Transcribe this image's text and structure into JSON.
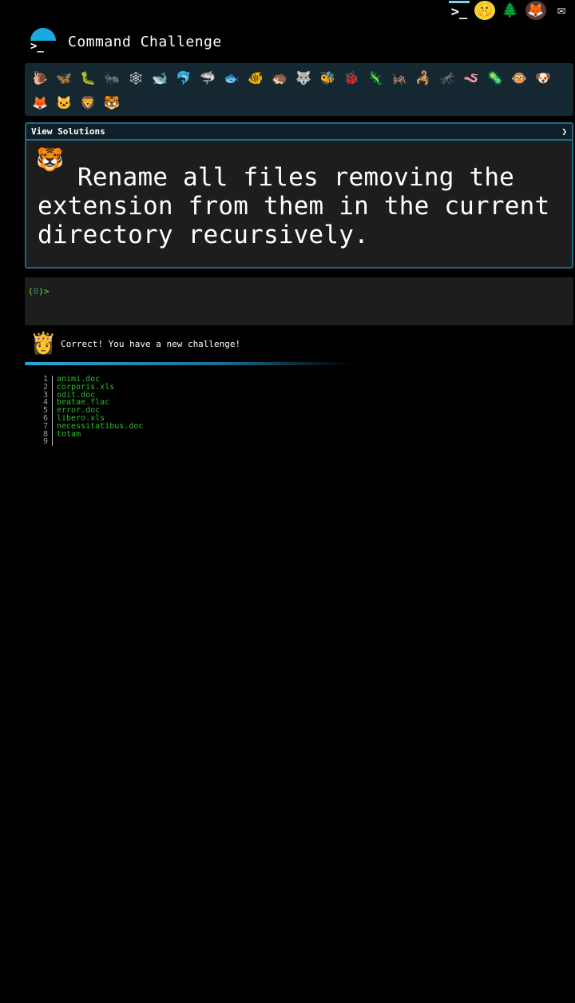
{
  "topbar": {
    "icons": [
      {
        "name": "terminal-icon",
        "glyph": ">_"
      },
      {
        "name": "quiet-face-icon",
        "glyph": "🤫"
      },
      {
        "name": "tree-icon",
        "glyph": "🌲"
      },
      {
        "name": "gitlab-icon",
        "glyph": "🦊"
      },
      {
        "name": "mail-icon",
        "glyph": "✉"
      }
    ]
  },
  "header": {
    "logo_prompt": ">_",
    "title": "Command Challenge"
  },
  "animals": [
    {
      "glyph": "🐌"
    },
    {
      "glyph": "🦋"
    },
    {
      "glyph": "🐛"
    },
    {
      "glyph": "🐜"
    },
    {
      "glyph": "🕸"
    },
    {
      "glyph": "🐋"
    },
    {
      "glyph": "🐬"
    },
    {
      "glyph": "🦈"
    },
    {
      "glyph": "🐟"
    },
    {
      "glyph": "🐠"
    },
    {
      "glyph": "🦔"
    },
    {
      "glyph": "🐺"
    },
    {
      "glyph": "🐝"
    },
    {
      "glyph": "🐞"
    },
    {
      "glyph": "🦎"
    },
    {
      "glyph": "🦗"
    },
    {
      "glyph": "🦂"
    },
    {
      "glyph": "🦟"
    },
    {
      "glyph": "🪱"
    },
    {
      "glyph": "🦠"
    },
    {
      "glyph": "🐵"
    },
    {
      "glyph": "🐶"
    },
    {
      "glyph": "🦊"
    },
    {
      "glyph": "🐱"
    },
    {
      "glyph": "🦁"
    },
    {
      "glyph": "🐯"
    }
  ],
  "challenge": {
    "toggle_label": "View Solutions",
    "toggle_chevron": "❯",
    "avatar": "🐯",
    "text": "Rename all files removing the extension from them in the current directory recursively."
  },
  "terminal": {
    "prompt_open": "(",
    "prompt_code": "0",
    "prompt_close": ")>"
  },
  "feedback": {
    "avatar": "👸",
    "message": "Correct! You have a new challenge!"
  },
  "listing": [
    {
      "num": "1",
      "file": "animi.doc"
    },
    {
      "num": "2",
      "file": "corporis.xls"
    },
    {
      "num": "3",
      "file": "odit.doc"
    },
    {
      "num": "4",
      "file": "beatae.flac"
    },
    {
      "num": "5",
      "file": "error.doc"
    },
    {
      "num": "6",
      "file": "libero.xls"
    },
    {
      "num": "7",
      "file": "necessitatibus.doc"
    },
    {
      "num": "8",
      "file": "totam"
    },
    {
      "num": "9",
      "file": ""
    }
  ]
}
